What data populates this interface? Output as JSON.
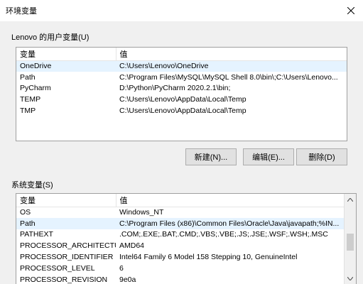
{
  "window": {
    "title": "环境变量"
  },
  "user_vars": {
    "group_label": "Lenovo 的用户变量(U)",
    "col_name": "变量",
    "col_value": "值",
    "rows": [
      {
        "name": "OneDrive",
        "value": "C:\\Users\\Lenovo\\OneDrive",
        "selected": true
      },
      {
        "name": "Path",
        "value": "C:\\Program Files\\MySQL\\MySQL Shell 8.0\\bin\\;C:\\Users\\Lenovo...",
        "selected": false
      },
      {
        "name": "PyCharm",
        "value": "D:\\Python\\PyCharm 2020.2.1\\bin;",
        "selected": false
      },
      {
        "name": "TEMP",
        "value": "C:\\Users\\Lenovo\\AppData\\Local\\Temp",
        "selected": false
      },
      {
        "name": "TMP",
        "value": "C:\\Users\\Lenovo\\AppData\\Local\\Temp",
        "selected": false
      }
    ],
    "buttons": {
      "new": "新建(N)...",
      "edit": "编辑(E)...",
      "delete": "删除(D)"
    }
  },
  "system_vars": {
    "group_label": "系统变量(S)",
    "col_name": "变量",
    "col_value": "值",
    "rows": [
      {
        "name": "OS",
        "value": "Windows_NT",
        "selected": false
      },
      {
        "name": "Path",
        "value": "C:\\Program Files (x86)\\Common Files\\Oracle\\Java\\javapath;%IN...",
        "selected": true
      },
      {
        "name": "PATHEXT",
        "value": ".COM;.EXE;.BAT;.CMD;.VBS;.VBE;.JS;.JSE;.WSF;.WSH;.MSC",
        "selected": false
      },
      {
        "name": "PROCESSOR_ARCHITECTURE",
        "value": "AMD64",
        "selected": false
      },
      {
        "name": "PROCESSOR_IDENTIFIER",
        "value": "Intel64 Family 6 Model 158 Stepping 10, GenuineIntel",
        "selected": false
      },
      {
        "name": "PROCESSOR_LEVEL",
        "value": "6",
        "selected": false
      },
      {
        "name": "PROCESSOR_REVISION",
        "value": "9e0a",
        "selected": false
      }
    ]
  }
}
